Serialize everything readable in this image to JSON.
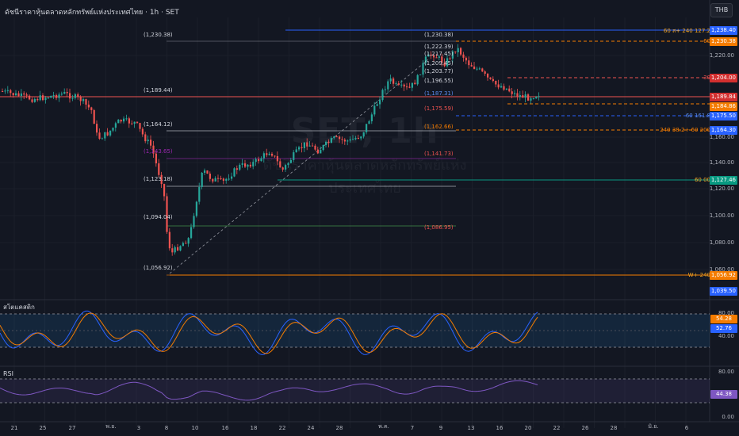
{
  "title": "ดัชนีราคาหุ้นตลาดหลักทรัพย์แห่งประเทศไทย · 1h · SET",
  "currency": "THB",
  "watermark": {
    "symbol": "SET, 1h",
    "subtitle": "ดัชนีราคาหุ้นตลาดหลักทรัพย์แห่งประเทศไทย"
  },
  "price_axis": [
    "1,220.00",
    "1,160.00",
    "1,140.00",
    "1,120.00",
    "1,100.00",
    "1,080.00",
    "1,060.00"
  ],
  "price_tags": [
    {
      "text": "1,238.40",
      "color": "#2962ff"
    },
    {
      "text": "1,230.38",
      "color": "#f57c00"
    },
    {
      "text": "1,204.00",
      "color": "#d32f2f"
    },
    {
      "text": "1,189.84",
      "color": "#d32f2f"
    },
    {
      "text": "1,184.86",
      "color": "#f57c00"
    },
    {
      "text": "1,175.50",
      "color": "#2962ff"
    },
    {
      "text": "1,164.30",
      "color": "#2962ff"
    },
    {
      "text": "1,127.46",
      "color": "#089981"
    },
    {
      "text": "1,056.92",
      "color": "#f57c00"
    },
    {
      "text": "1,039.50",
      "color": "#2962ff"
    }
  ],
  "line_labels": [
    {
      "text": "60 ส+ 240 127.2",
      "color": "#f5a623"
    },
    {
      "text": "60",
      "color": "#f57c00"
    },
    {
      "text": "30",
      "color": "#ef5350"
    },
    {
      "text": "60 161.8",
      "color": "#5b8def"
    },
    {
      "text": "240 38.2+ 60 200",
      "color": "#f57c00"
    },
    {
      "text": "60 00",
      "color": "#f5a623"
    },
    {
      "text": "W+ 240",
      "color": "#f5a623"
    }
  ],
  "fib_labels": [
    {
      "text": "(1,230.38)",
      "color": "#d1d4dc"
    },
    {
      "text": "(1,189.44)",
      "color": "#d1d4dc"
    },
    {
      "text": "(1,164.12)",
      "color": "#d1d4dc"
    },
    {
      "text": "(1,143.65)",
      "color": "#9c27b0"
    },
    {
      "text": "(1,123.18)",
      "color": "#d1d4dc"
    },
    {
      "text": "(1,094.04)",
      "color": "#d1d4dc"
    },
    {
      "text": "(1,056.92)",
      "color": "#d1d4dc"
    },
    {
      "text": "(1,230.38)",
      "color": "#d1d4dc"
    },
    {
      "text": "(1,222.39)",
      "color": "#d1d4dc"
    },
    {
      "text": "(1,217.45)",
      "color": "#d1d4dc"
    },
    {
      "text": "(1,209.45)",
      "color": "#d1d4dc"
    },
    {
      "text": "(1,203.77)",
      "color": "#d1d4dc"
    },
    {
      "text": "(1,196.55)",
      "color": "#d1d4dc"
    },
    {
      "text": "(1,187.31)",
      "color": "#5b8def"
    },
    {
      "text": "(1,175.59)",
      "color": "#ef5350"
    },
    {
      "text": "(1,162.66)",
      "color": "#f57c00"
    },
    {
      "text": "(1,141.73)",
      "color": "#ef5350"
    },
    {
      "text": "(1,086.95)",
      "color": "#ef5350"
    }
  ],
  "stoch": {
    "label": "สโตแคสติก",
    "axis": [
      "80.00",
      "40.00"
    ],
    "tag1": "54.28",
    "tag2": "52.76"
  },
  "rsi": {
    "label": "RSI",
    "axis": [
      "80.00",
      "0.00"
    ],
    "tag": "44.38"
  },
  "dates": [
    "21",
    "25",
    "27",
    "พ.ย.",
    "3",
    "8",
    "10",
    "16",
    "18",
    "22",
    "24",
    "28",
    "พ.ค.",
    "7",
    "9",
    "13",
    "16",
    "20",
    "22",
    "26",
    "28",
    "มิ.ย.",
    "6"
  ],
  "colors": {
    "bg": "#131722",
    "up": "#26a69a",
    "down": "#ef5350",
    "grid": "#1e222d"
  }
}
